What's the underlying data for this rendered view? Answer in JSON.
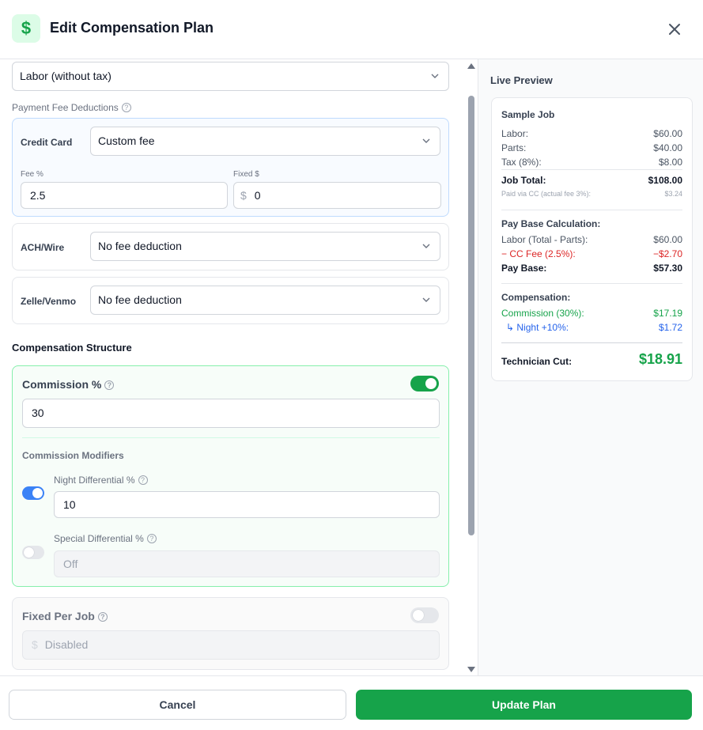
{
  "header": {
    "title": "Edit Compensation Plan",
    "logo_glyph": "$",
    "logo_icon": "dollar-icon",
    "close_icon": "close-icon"
  },
  "form": {
    "pay_base_select": "Labor (without tax)",
    "payment_fee_label": "Payment Fee Deductions",
    "credit_card": {
      "label": "Credit Card",
      "select": "Custom fee",
      "fee_pct_label": "Fee %",
      "fee_pct_value": "2.5",
      "fixed_label": "Fixed $",
      "fixed_prefix": "$",
      "fixed_value": "0"
    },
    "ach": {
      "label": "ACH/Wire",
      "select": "No fee deduction"
    },
    "zelle": {
      "label": "Zelle/Venmo",
      "select": "No fee deduction"
    },
    "structure_title": "Compensation Structure",
    "commission": {
      "label": "Commission %",
      "enabled": true,
      "value": "30",
      "modifiers_title": "Commission Modifiers",
      "night": {
        "label": "Night Differential %",
        "enabled": true,
        "value": "10"
      },
      "special": {
        "label": "Special Differential %",
        "enabled": false,
        "placeholder": "Off"
      }
    },
    "fixed_per_job": {
      "label": "Fixed Per Job",
      "enabled": false,
      "prefix": "$",
      "placeholder": "Disabled"
    },
    "help_glyph": "?"
  },
  "preview": {
    "title": "Live Preview",
    "sample_job": "Sample Job",
    "labor_label": "Labor:",
    "labor_value": "$60.00",
    "parts_label": "Parts:",
    "parts_value": "$40.00",
    "tax_label": "Tax (8%):",
    "tax_value": "$8.00",
    "total_label": "Job Total:",
    "total_value": "$108.00",
    "paid_note": "Paid via CC (actual fee 3%):",
    "paid_note_value": "$3.24",
    "pay_base_title": "Pay Base Calculation:",
    "labor_minus_label": "Labor (Total - Parts):",
    "labor_minus_value": "$60.00",
    "cc_fee_label": "− CC Fee (2.5%):",
    "cc_fee_value": "−$2.70",
    "pay_base_label": "Pay Base:",
    "pay_base_value": "$57.30",
    "comp_title": "Compensation:",
    "commission_label": "Commission (30%):",
    "commission_value": "$17.19",
    "night_label": "↳ Night +10%:",
    "night_value": "$1.72",
    "cut_label": "Technician Cut:",
    "cut_value": "$18.91"
  },
  "footer": {
    "cancel": "Cancel",
    "update": "Update Plan"
  },
  "colors": {
    "brand_green": "#16a34a",
    "toggle_blue": "#3b82f6",
    "fee_red": "#dc2626",
    "modifier_blue": "#2563eb"
  }
}
